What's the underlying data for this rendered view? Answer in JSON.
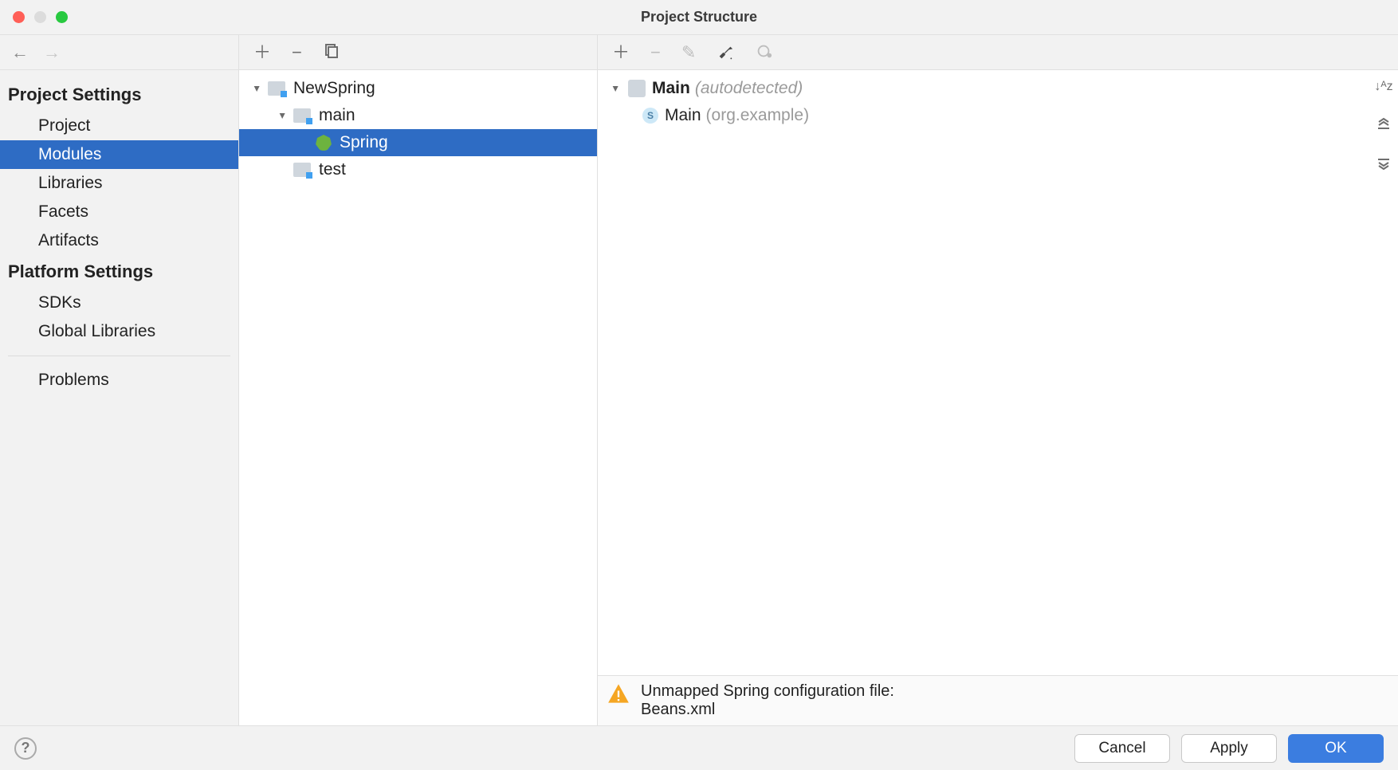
{
  "window": {
    "title": "Project Structure"
  },
  "sidebar": {
    "sections": [
      {
        "header": "Project Settings",
        "items": [
          {
            "label": "Project"
          },
          {
            "label": "Modules"
          },
          {
            "label": "Libraries"
          },
          {
            "label": "Facets"
          },
          {
            "label": "Artifacts"
          }
        ]
      },
      {
        "header": "Platform Settings",
        "items": [
          {
            "label": "SDKs"
          },
          {
            "label": "Global Libraries"
          }
        ]
      },
      {
        "header": "",
        "items": [
          {
            "label": "Problems"
          }
        ]
      }
    ],
    "selected": "Modules"
  },
  "modules_tree": {
    "root": "NewSpring",
    "children": [
      {
        "label": "main",
        "children": [
          {
            "label": "Spring",
            "type": "spring"
          }
        ]
      },
      {
        "label": "test"
      }
    ],
    "selected": "Spring"
  },
  "facet_panel": {
    "context_name": "Main",
    "context_hint": "(autodetected)",
    "bean_name": "Main",
    "bean_package": "(org.example)"
  },
  "warning": {
    "line1": "Unmapped Spring configuration file:",
    "line2": "Beans.xml"
  },
  "footer": {
    "cancel": "Cancel",
    "apply": "Apply",
    "ok": "OK"
  }
}
